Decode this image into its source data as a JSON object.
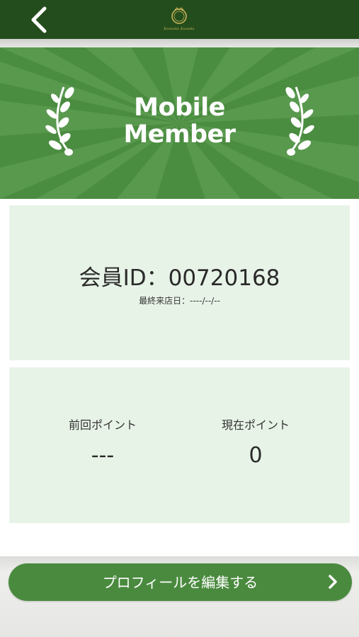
{
  "header": {
    "back_icon": "chevron-left-icon",
    "logo_text": "Kaname Kasada",
    "background": "#234d1c"
  },
  "banner": {
    "title_line1": "Mobile",
    "title_line2": "Member",
    "background": "#4a8c40",
    "decoration_icon": "laurel-icon"
  },
  "member": {
    "id_text": "会員ID：00720168",
    "last_visit_text": "最終来店日：----/--/--"
  },
  "points": {
    "previous_label": "前回ポイント",
    "previous_value": "---",
    "current_label": "現在ポイント",
    "current_value": "0"
  },
  "actions": {
    "edit_profile_label": "プロフィールを編集する",
    "edit_profile_icon": "chevron-right-icon",
    "accent": "#4a8a3f"
  }
}
